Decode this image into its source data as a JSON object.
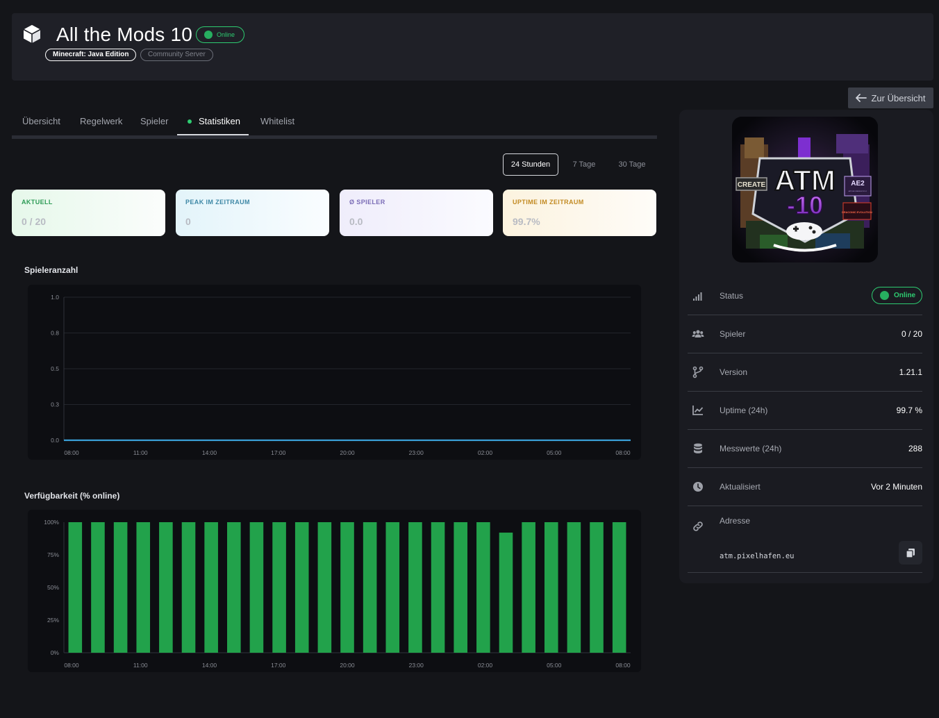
{
  "header": {
    "title": "All the Mods 10",
    "status": "Online",
    "tags": [
      "Minecraft: Java Edition",
      "Community Server"
    ],
    "back_label": "Zur Übersicht"
  },
  "tabs": [
    {
      "label": "Übersicht",
      "active": false
    },
    {
      "label": "Regelwerk",
      "active": false
    },
    {
      "label": "Spieler",
      "active": false
    },
    {
      "label": "Statistiken",
      "active": true
    },
    {
      "label": "Whitelist",
      "active": false
    }
  ],
  "ranges": [
    {
      "label": "24 Stunden",
      "active": true
    },
    {
      "label": "7 Tage",
      "active": false
    },
    {
      "label": "30 Tage",
      "active": false
    }
  ],
  "cards": [
    {
      "label": "AKTUELL",
      "value": "0 / 20"
    },
    {
      "label": "PEAK IM ZEITRAUM",
      "value": "0"
    },
    {
      "label": "Ø SPIELER",
      "value": "0.0"
    },
    {
      "label": "UPTIME IM ZEITRAUM",
      "value": "99.7%"
    }
  ],
  "colors": {
    "online": "#2ecc71",
    "bar": "#22a24b",
    "line": "#3aa0d8",
    "panel": "#1a1b21"
  },
  "chart_data": [
    {
      "type": "line",
      "title": "Spieleranzahl",
      "x_ticks": [
        "08:00",
        "11:00",
        "14:00",
        "17:00",
        "20:00",
        "23:00",
        "02:00",
        "05:00",
        "08:00"
      ],
      "y_ticks": [
        "0.0",
        "0.3",
        "0.5",
        "0.8",
        "1.0"
      ],
      "ylim": [
        0,
        1
      ],
      "series": [
        {
          "values": [
            0,
            0,
            0,
            0,
            0,
            0,
            0,
            0,
            0
          ]
        }
      ],
      "grid": true
    },
    {
      "type": "bar",
      "title": "Verfügbarkeit (% online)",
      "x_ticks": [
        "08:00",
        "11:00",
        "14:00",
        "17:00",
        "20:00",
        "23:00",
        "02:00",
        "05:00",
        "08:00"
      ],
      "y_ticks": [
        "0%",
        "25%",
        "50%",
        "75%",
        "100%"
      ],
      "ylim": [
        0,
        100
      ],
      "values": [
        100,
        100,
        100,
        100,
        100,
        100,
        100,
        100,
        100,
        100,
        100,
        100,
        100,
        100,
        100,
        100,
        100,
        100,
        100,
        92,
        100,
        100,
        100,
        100,
        100
      ],
      "grid": false
    }
  ],
  "sidebar": {
    "rows": [
      {
        "key": "Status",
        "value": "Online",
        "icon": "signal-icon"
      },
      {
        "key": "Spieler",
        "value": "0 / 20",
        "icon": "users-icon"
      },
      {
        "key": "Version",
        "value": "1.21.1",
        "icon": "branch-icon"
      },
      {
        "key": "Uptime (24h)",
        "value": "99.7 %",
        "icon": "chart-line-icon"
      },
      {
        "key": "Messwerte (24h)",
        "value": "288",
        "icon": "database-icon"
      },
      {
        "key": "Aktualisiert",
        "value": "Vor 2 Minuten",
        "icon": "clock-icon"
      }
    ],
    "address_label": "Adresse",
    "address": "atm.pixelhafen.eu",
    "logo": {
      "main": "ATM",
      "number": "-10",
      "badges": [
        "CREATE",
        "AE2",
        "APPLIED ENERGISTICS 2",
        "DRACONIC EVOLUTION"
      ]
    }
  }
}
